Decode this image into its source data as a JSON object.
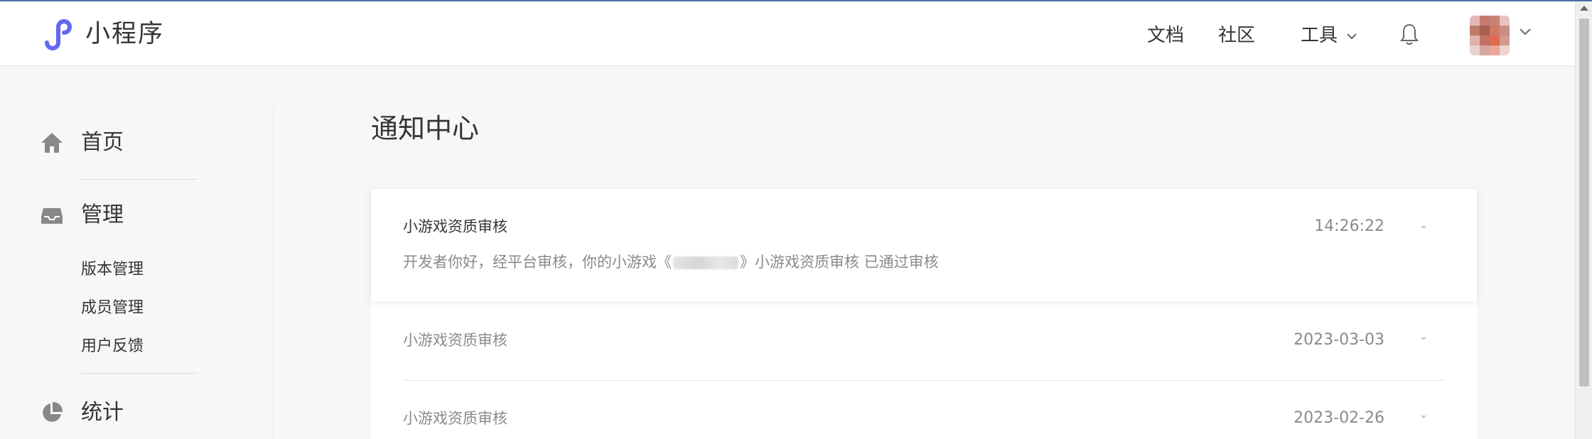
{
  "header": {
    "app_title": "小程序",
    "nav": {
      "docs": "文档",
      "community": "社区",
      "tools": "工具"
    },
    "avatar_colors": [
      "#e2b9b4",
      "#c97a6e",
      "#c98276",
      "#e6c3bd",
      "#bf7a6c",
      "#a86050",
      "#d07a66",
      "#c98d84",
      "#deb3ab",
      "#c47064",
      "#e06a52",
      "#d29a90",
      "#ead3cf",
      "#d7a79f",
      "#e8a898",
      "#ecd4cf"
    ]
  },
  "sidebar": {
    "home": "首页",
    "manage": "管理",
    "manage_items": [
      "版本管理",
      "成员管理",
      "用户反馈"
    ],
    "stats": "统计"
  },
  "main": {
    "page_title": "通知中心",
    "notifications": [
      {
        "title": "小游戏资质审核",
        "time": "14:26:22",
        "expanded": true,
        "body_prefix": "开发者你好，经平台审核，你的小游戏《",
        "body_suffix": "》小游戏资质审核 已通过审核"
      },
      {
        "title": "小游戏资质审核",
        "time": "2023-03-03",
        "expanded": false
      },
      {
        "title": "小游戏资质审核",
        "time": "2023-02-26",
        "expanded": false
      }
    ]
  },
  "colors": {
    "logo": "#6467f0",
    "page_bg": "#f6f7f9",
    "text": "#353535",
    "muted": "#8a8a8a"
  }
}
